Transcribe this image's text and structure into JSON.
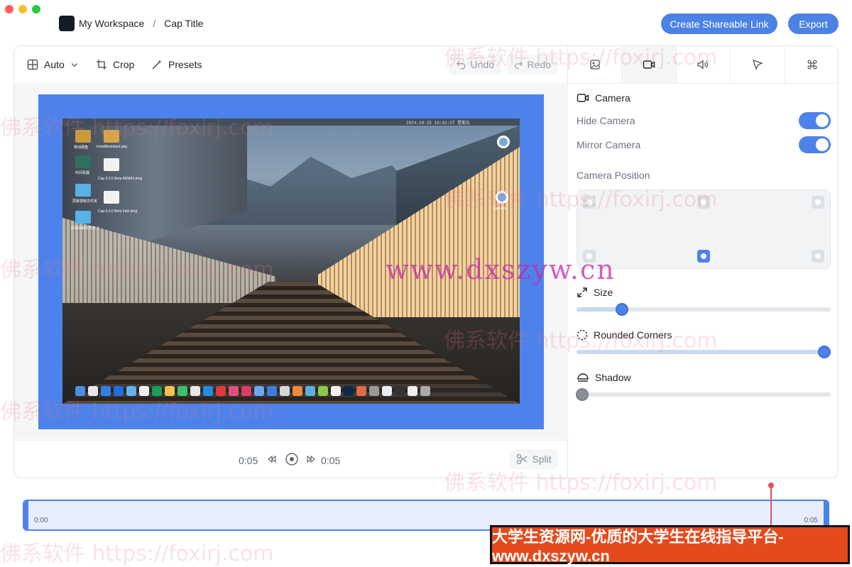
{
  "titlebar": {
    "workspace": "My Workspace",
    "separator": "/",
    "project_title": "Cap Title",
    "share_label": "Create Shareable Link",
    "export_label": "Export"
  },
  "toolbar": {
    "aspect_label": "Auto",
    "crop_label": "Crop",
    "presets_label": "Presets",
    "undo_label": "Undo",
    "redo_label": "Redo"
  },
  "preview": {
    "menubar_date": "2024-10-25 19:42:27 星期五",
    "desktop_labels": [
      "移动硬盘",
      "InstallAssistant.pkg",
      "时间机器",
      "Cap 0.3.0 Beta ARM64.dmg",
      "屏幕录制文件夹",
      "Cap 0.3.0 Beta Intel.dmg",
      "屏幕录制文件夹 2"
    ],
    "cap_label": "Cap.dmg"
  },
  "playback": {
    "current_time": "0:05",
    "total_time": "0:05",
    "split_label": "Split"
  },
  "sidebar": {
    "tabs": [
      "background-icon",
      "camera-icon",
      "audio-icon",
      "cursor-icon",
      "shortcuts-icon"
    ],
    "active_tab": 1,
    "camera_title": "Camera",
    "hide_camera_label": "Hide Camera",
    "hide_camera_on": true,
    "mirror_camera_label": "Mirror Camera",
    "mirror_camera_on": true,
    "position_label": "Camera Position",
    "position_selected": "bottom-center",
    "size_label": "Size",
    "size_value": 0.18,
    "rounded_label": "Rounded Corners",
    "rounded_value": 1.0,
    "shadow_label": "Shadow",
    "shadow_value": 0.0
  },
  "timeline": {
    "start": "0:00",
    "end": "0:05"
  },
  "watermarks": {
    "text": "佛系软件 https://foxirj.com",
    "site": "www.dxszyw.cn",
    "banner": "大学生资源网-优质的大学生在线指导平台-www.dxszyw.cn"
  },
  "colors": {
    "accent": "#4e82eb",
    "playhead": "#e05060",
    "banner_bg": "#e54a1c"
  }
}
